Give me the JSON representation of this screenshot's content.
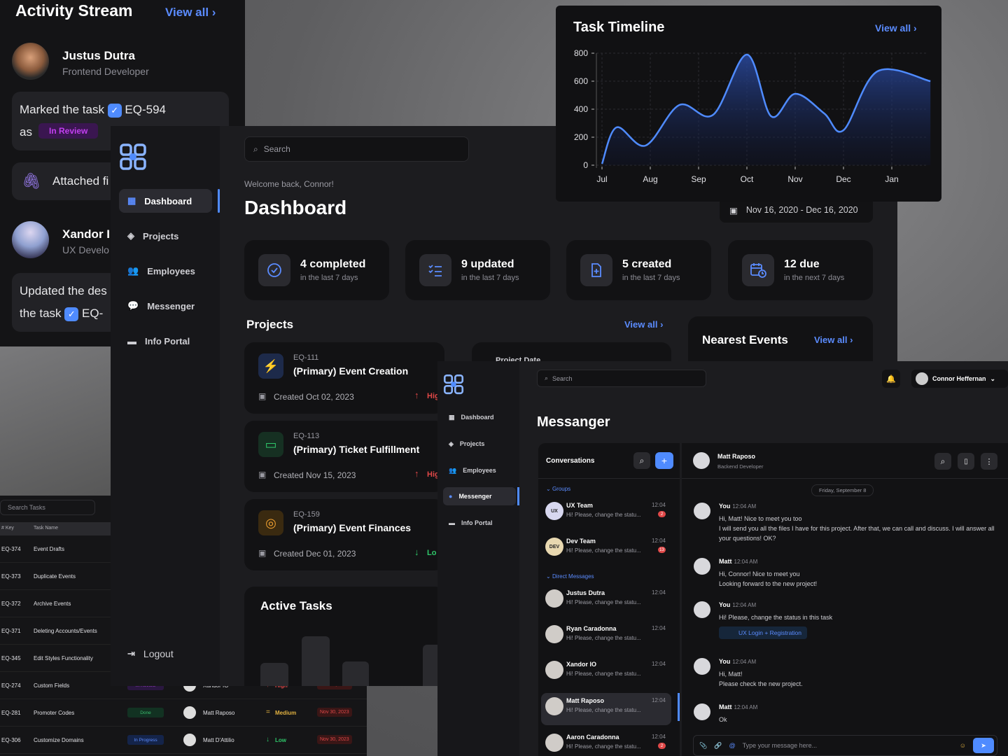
{
  "activity": {
    "title": "Activity Stream",
    "view_all": "View all",
    "user1": {
      "name": "Justus Dutra",
      "role": "Frontend Developer"
    },
    "card1": {
      "text": "Marked the task",
      "task": "EQ-594",
      "as": "as",
      "status": "In Review"
    },
    "card2": {
      "text": "Attached fi"
    },
    "user2": {
      "name": "Xandor I",
      "role": "UX Develo"
    },
    "card3": {
      "line1": "Updated the des",
      "line2": "the task",
      "task": "EQ-"
    }
  },
  "sidebar": {
    "items": [
      {
        "label": "Dashboard",
        "icon": "grid-icon"
      },
      {
        "label": "Projects",
        "icon": "layers-icon"
      },
      {
        "label": "Employees",
        "icon": "users-icon"
      },
      {
        "label": "Messenger",
        "icon": "chat-icon"
      },
      {
        "label": "Info Portal",
        "icon": "folder-icon"
      }
    ],
    "logout": "Logout"
  },
  "dashboard": {
    "search_placeholder": "Search",
    "welcome": "Welcome back, Connor!",
    "title": "Dashboard",
    "date_range": "Nov 16, 2020 - Dec 16, 2020",
    "stats": [
      {
        "big": "4 completed",
        "small": "in the last 7 days"
      },
      {
        "big": "9 updated",
        "small": "in the last 7 days"
      },
      {
        "big": "5 created",
        "small": "in the last 7 days"
      },
      {
        "big": "12 due",
        "small": "in the next 7 days"
      }
    ],
    "projects_title": "Projects",
    "projects_view_all": "View all",
    "project_date_header": "Project Date",
    "projects": [
      {
        "key": "EQ-111",
        "name": "(Primary) Event Creation",
        "created": "Created Oct 02, 2023",
        "priority": "Hig"
      },
      {
        "key": "EQ-113",
        "name": "(Primary) Ticket Fulfillment",
        "created": "Created Nov 15, 2023",
        "priority": "Hig"
      },
      {
        "key": "EQ-159",
        "name": "(Primary) Event Finances",
        "created": "Created Dec 01, 2023",
        "priority": "Lo"
      }
    ],
    "active_tasks": "Active Tasks",
    "nearest_events": "Nearest Events",
    "events_view_all": "View all"
  },
  "timeline": {
    "title": "Task Timeline",
    "view_all": "View all"
  },
  "chart_data": {
    "type": "area",
    "x": [
      "Jul",
      "Aug",
      "Sep",
      "Oct",
      "Nov",
      "Dec",
      "Jan"
    ],
    "yticks": [
      0,
      200,
      400,
      600,
      800
    ],
    "ylim": [
      0,
      800
    ],
    "series": [
      {
        "points": [
          [
            0,
            10
          ],
          [
            0.3,
            270
          ],
          [
            0.9,
            140
          ],
          [
            1.6,
            430
          ],
          [
            2.3,
            360
          ],
          [
            3,
            790
          ],
          [
            3.5,
            350
          ],
          [
            4,
            510
          ],
          [
            4.6,
            370
          ],
          [
            5,
            250
          ],
          [
            5.7,
            670
          ],
          [
            6.8,
            600
          ]
        ]
      }
    ],
    "grid": true,
    "color": "#4f8bff"
  },
  "table": {
    "search_placeholder": "Search Tasks",
    "headers": [
      "# Key",
      "Task Name"
    ],
    "rows": [
      {
        "key": "EQ-374",
        "name": "Event Drafts"
      },
      {
        "key": "EQ-373",
        "name": "Duplicate Events"
      },
      {
        "key": "EQ-372",
        "name": "Archive Events"
      },
      {
        "key": "EQ-371",
        "name": "Deleting Accounts/Events"
      },
      {
        "key": "EQ-345",
        "name": "Edit Styles Functionality"
      },
      {
        "key": "EQ-274",
        "name": "Custom Fields",
        "status": "In Review",
        "assignee": "Xandor IO",
        "priority": "High",
        "date": "Nov 30, 2023"
      },
      {
        "key": "EQ-281",
        "name": "Promoter Codes",
        "status": "Done",
        "assignee": "Matt Raposo",
        "priority": "Medium",
        "date": "Nov 30, 2023"
      },
      {
        "key": "EQ-306",
        "name": "Customize Domains",
        "status": "In Progress",
        "assignee": "Matt D'Attilio",
        "priority": "Low",
        "date": "Nov 30, 2023"
      }
    ]
  },
  "messenger_nav": {
    "items": [
      "Dashboard",
      "Projects",
      "Employees",
      "Messenger",
      "Info Portal"
    ]
  },
  "messenger": {
    "search_placeholder": "Search",
    "user": "Connor Heffernan",
    "title": "Messanger",
    "conversations": "Conversations",
    "groups_label": "Groups",
    "dm_label": "Direct Messages",
    "groups": [
      {
        "name": "UX Team",
        "abbr": "UX",
        "preview": "Hi! Please, change the statu...",
        "time": "12:04",
        "badge": "2"
      },
      {
        "name": "Dev Team",
        "abbr": "DEV",
        "preview": "Hi! Please, change the statu...",
        "time": "12:04",
        "badge": "13"
      }
    ],
    "dms": [
      {
        "name": "Justus Dutra",
        "preview": "Hi! Please, change the statu...",
        "time": "12:04"
      },
      {
        "name": "Ryan Caradonna",
        "preview": "Hi! Please, change the statu...",
        "time": "12:04"
      },
      {
        "name": "Xandor IO",
        "preview": "Hi! Please, change the statu...",
        "time": "12:04"
      },
      {
        "name": "Matt Raposo",
        "preview": "Hi! Please, change the statu...",
        "time": "12:04"
      },
      {
        "name": "Aaron Caradonna",
        "preview": "Hi! Please, change the statu...",
        "time": "12:04",
        "badge": "2"
      }
    ],
    "chat": {
      "name": "Matt Raposo",
      "role": "Backend Developer",
      "date": "Friday, September 8",
      "messages": [
        {
          "who": "You",
          "time": "12:04 AM",
          "lines": "Hi, Matt! Nice to meet you too\nI will send you all the files I have for this project. After that, we can call and discuss. I will answer all your questions! OK?"
        },
        {
          "who": "Matt",
          "time": "12:04 AM",
          "lines": "Hi, Connor! Nice to meet you\nLooking forward to the new project!"
        },
        {
          "who": "You",
          "time": "12:04 AM",
          "lines": "Hi! Please, change the status in this task",
          "link": "UX Login + Registration"
        },
        {
          "who": "You",
          "time": "12:04 AM",
          "lines": "Hi, Matt!\nPlease check the new project."
        },
        {
          "who": "Matt",
          "time": "12:04 AM",
          "lines": "Ok"
        }
      ],
      "input_placeholder": "Type your message here..."
    }
  }
}
